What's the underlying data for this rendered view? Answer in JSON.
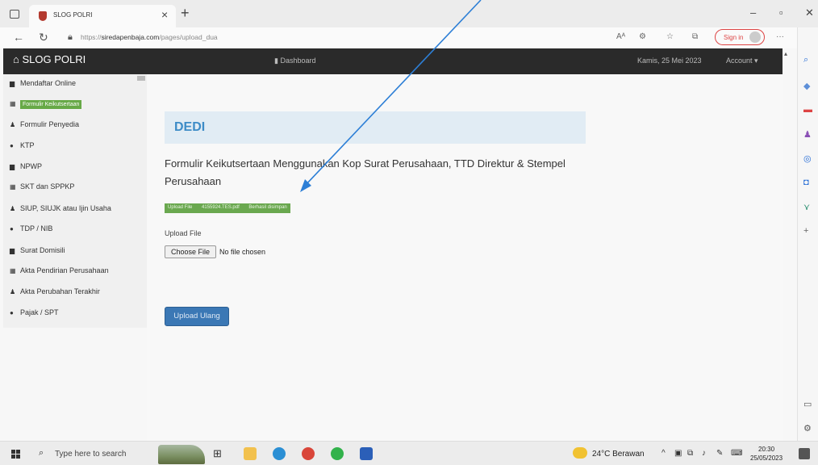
{
  "browser": {
    "tab_title": "SLOG POLRI",
    "url_prefix": "https://",
    "url_domain": "siredapenbaja.com",
    "url_path": "/pages/upload_dua",
    "signin_label": "Sign in"
  },
  "navbar": {
    "brand": "SLOG POLRI",
    "dashboard": "Dashboard",
    "date": "Kamis, 25 Mei 2023",
    "account": "Account"
  },
  "sidebar": {
    "items": [
      {
        "label": "Mendaftar Online",
        "icon": "briefcase-icon"
      },
      {
        "label": "Formulir Keikutsertaan",
        "icon": "grid-icon"
      },
      {
        "label": "Formulir Penyedia",
        "icon": "user-icon"
      },
      {
        "label": "KTP",
        "icon": "circle-icon"
      },
      {
        "label": "NPWP",
        "icon": "briefcase-icon"
      },
      {
        "label": "SKT dan SPPKP",
        "icon": "grid-icon"
      },
      {
        "label": "SIUP, SIUJK atau Ijin Usaha",
        "icon": "user-icon"
      },
      {
        "label": "TDP / NIB",
        "icon": "circle-icon"
      },
      {
        "label": "Surat Domisili",
        "icon": "briefcase-icon"
      },
      {
        "label": "Akta Pendirian Perusahaan",
        "icon": "grid-icon"
      },
      {
        "label": "Akta Perubahan Terakhir",
        "icon": "user-icon"
      },
      {
        "label": "Pajak / SPT",
        "icon": "circle-icon"
      }
    ],
    "active_index": 1
  },
  "main": {
    "panel_title": "DEDI",
    "heading": "Formulir Keikutsertaan Menggunakan Kop Surat Perusahaan, TTD Direktur & Stempel Perusahaan",
    "badge_label": "Upload File",
    "badge_file": "4155924.TES.pdf",
    "badge_status": "Berhasil disimpan",
    "upload_label": "Upload File",
    "choose_button": "Choose File",
    "no_file": "No file chosen",
    "upload_again": "Upload Ulang"
  },
  "taskbar": {
    "search_placeholder": "Type here to search",
    "weather": "24°C Berawan",
    "time": "20:30",
    "date": "25/05/2023"
  },
  "colors": {
    "navbar": "#2a2a2a",
    "active_green": "#67a947",
    "panel_blue": "#e1ecf4",
    "title_blue": "#3d8cc7",
    "button_blue": "#3b78b5",
    "arrow_blue": "#2d7fd6"
  }
}
